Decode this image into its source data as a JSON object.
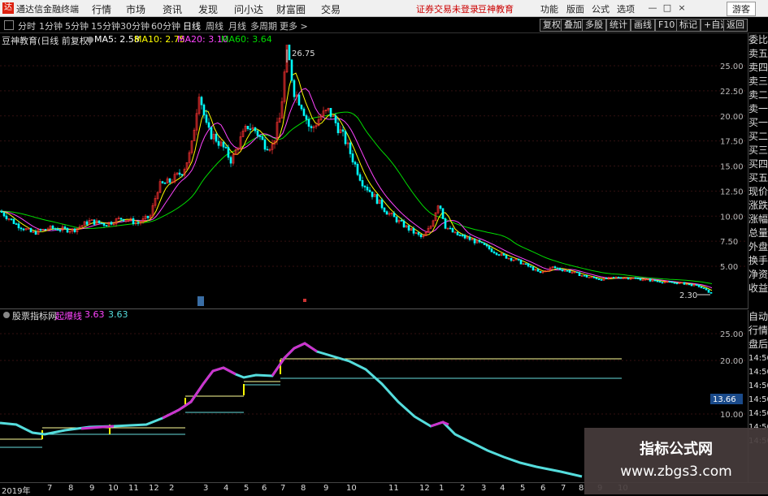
{
  "app": {
    "title": "通达信金融终端",
    "logo_glyph": "达",
    "menu": [
      "行情",
      "市场",
      "资讯",
      "发现",
      "问小达",
      "财富圈",
      "交易"
    ],
    "notice": [
      "证券交易未登录",
      "豆神教育"
    ],
    "right_menu": [
      "功能",
      "版面",
      "公式",
      "选项"
    ],
    "guest": "游客",
    "window_buttons": [
      "—",
      "□",
      "×"
    ]
  },
  "toolbar": {
    "periods": [
      "分时",
      "1分钟",
      "5分钟",
      "15分钟",
      "30分钟",
      "60分钟",
      "日线",
      "周线",
      "月线",
      "多周期",
      "更多 >"
    ],
    "active_period": "日线",
    "buttons": [
      "复权",
      "叠加",
      "多股",
      "统计",
      "画线",
      "F10",
      "标记",
      "+自选",
      "返回"
    ]
  },
  "main_chart": {
    "stock_label": "豆神教育(日线 前复权)",
    "ma": [
      {
        "label": "MA5: 2.58",
        "color": "#ffffff"
      },
      {
        "label": "MA10: 2.75",
        "color": "#ffff00"
      },
      {
        "label": "MA20: 3.10",
        "color": "#ff44ff"
      },
      {
        "label": "MA60: 3.64",
        "color": "#00dd00"
      }
    ],
    "high_marker": "26.75",
    "low_marker": "2.30",
    "y_ticks": [
      "25.00",
      "22.50",
      "20.00",
      "17.50",
      "15.00",
      "12.50",
      "10.00",
      "7.50",
      "5.00"
    ]
  },
  "sub_chart": {
    "indicator_label": "股票指标网",
    "line_label": "起爆线",
    "value_magenta": "3.63",
    "value_cyan": "3.63",
    "y_ticks": [
      "25.00",
      "20.00",
      "10.00"
    ],
    "current_value": "13.66"
  },
  "right_panel": {
    "items_top": [
      "委比",
      "卖五",
      "卖四",
      "卖三",
      "卖二",
      "卖一",
      "买一",
      "买二",
      "买三",
      "买四",
      "买五",
      "现价",
      "涨跌",
      "涨幅",
      "总量",
      "外盘",
      "换手",
      "净资",
      "收益"
    ],
    "items_bottom": [
      "自动",
      "行情",
      "盘后",
      "14:50",
      "14:50",
      "14:50",
      "14:50",
      "14:50",
      "14:50",
      "14:50"
    ]
  },
  "x_axis": {
    "labels": [
      "2019年",
      "7",
      "8",
      "9",
      "10",
      "11",
      "12",
      "2",
      "3",
      "4",
      "5",
      "6",
      "7",
      "8",
      "9",
      "10",
      "11",
      "12",
      "1",
      "2",
      "3",
      "4",
      "5",
      "6",
      "7",
      "8",
      "9",
      "10"
    ]
  },
  "watermark": {
    "line1": "指标公式网",
    "line2": "www.zbgs3.com"
  },
  "colors": {
    "up": "#ff3333",
    "down": "#00ffff",
    "ma60": "#00dd00",
    "ma20": "#ff44ff",
    "indicator_line": "#55dddd",
    "indicator_up": "#cc33cc",
    "level_lines": "#ffff99"
  }
}
